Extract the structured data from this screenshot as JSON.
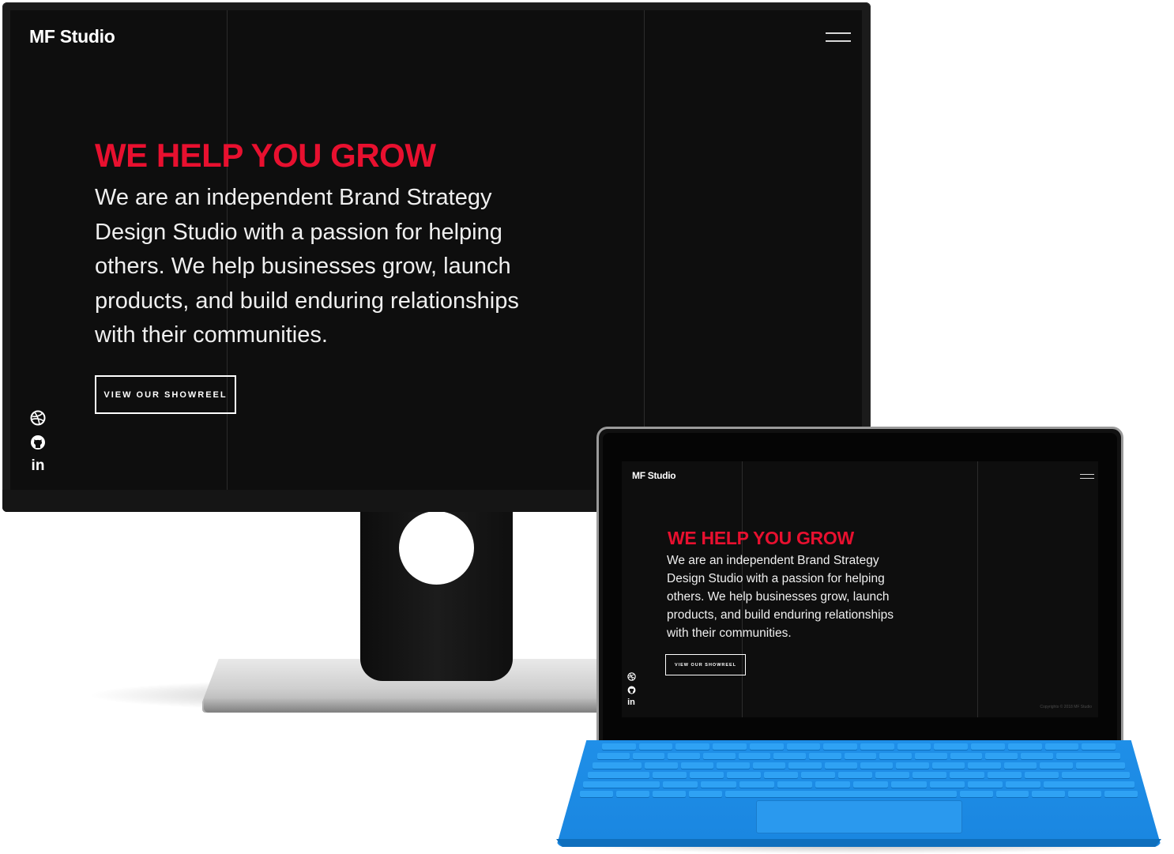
{
  "site": {
    "brand": "MF Studio",
    "hero_title": "WE HELP YOU GROW",
    "hero_lines": [
      "We are an independent Brand Strategy",
      "Design Studio with a passion for helping",
      "others. We help businesses grow, launch",
      "products, and build enduring relationships",
      "with their communities."
    ],
    "cta_label": "VIEW OUR SHOWREEL",
    "social_icons": [
      "dribbble-icon",
      "github-icon",
      "linkedin-icon"
    ],
    "linkedin_glyph": "in",
    "copyright": "Copyrights © 2018 MF Studio"
  },
  "colors": {
    "accent": "#e8102f",
    "background": "#0e0e0e",
    "text": "#efefef",
    "keyboard": "#1f8fe8"
  }
}
